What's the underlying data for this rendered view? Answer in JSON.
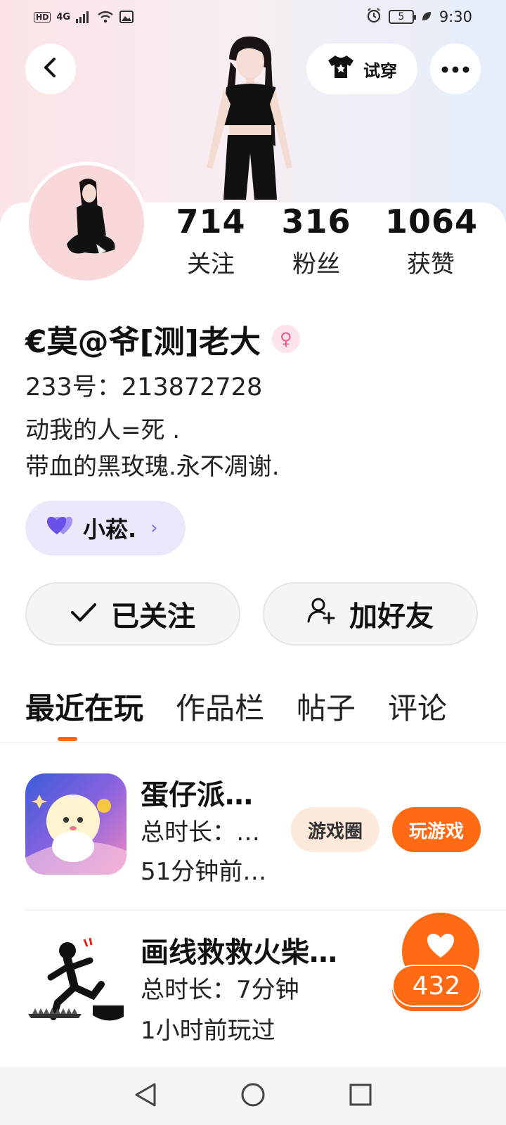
{
  "status_bar": {
    "left_items": [
      "HD",
      "4G",
      "signal-icon",
      "wifi-icon",
      "photo-icon"
    ],
    "battery": "5",
    "time": "9:30"
  },
  "header": {
    "tryon_label": "试穿"
  },
  "stats": [
    {
      "value": "714",
      "label": "关注"
    },
    {
      "value": "316",
      "label": "粉丝"
    },
    {
      "value": "1064",
      "label": "获赞"
    }
  ],
  "profile": {
    "name": "€莫@爷[测]老大",
    "gender": "female",
    "uid": "233号：213872728",
    "bio_line1": "动我的人=死 .",
    "bio_line2": "带血的黑玫瑰.永不凋谢.",
    "bond_tag": "小菘."
  },
  "actions": {
    "followed_label": "已关注",
    "add_friend_label": "加好友"
  },
  "tabs": [
    {
      "label": "最近在玩",
      "active": true
    },
    {
      "label": "作品栏",
      "active": false
    },
    {
      "label": "帖子",
      "active": false
    },
    {
      "label": "评论",
      "active": false
    }
  ],
  "games": [
    {
      "title": "蛋仔派…",
      "duration": "总时长：…",
      "last_played": "51分钟前…",
      "circle_label": "游戏圈",
      "play_label": "玩游戏"
    },
    {
      "title": "画线救救火柴…",
      "duration": "总时长：7分钟",
      "last_played": "1小时前玩过"
    }
  ],
  "like_count": "432",
  "colors": {
    "accent": "#ff6a13",
    "bond_bg": "#ece8fb",
    "pink": "#f0588e"
  }
}
